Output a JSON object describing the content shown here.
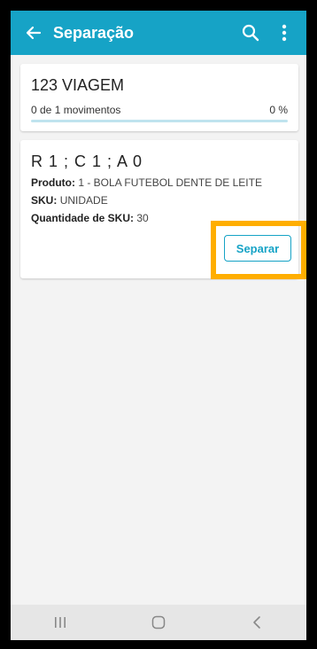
{
  "header": {
    "title": "Separação",
    "back_icon": "arrow-left-icon",
    "search_icon": "search-icon",
    "menu_icon": "more-vert-icon",
    "color": "#16a3c6"
  },
  "trip": {
    "name": "123 VIAGEM",
    "movements_text": "0 de 1 movimentos",
    "percent_text": "0 %",
    "progress": 0
  },
  "item": {
    "location": "R 1 ; C 1 ; A 0",
    "produto_label": "Produto:",
    "produto_value": "1 - BOLA FUTEBOL DENTE DE LEITE",
    "sku_label": "SKU:",
    "sku_value": "UNIDADE",
    "qty_label": "Quantidade de SKU:",
    "qty_value": "30",
    "button_label": "Separar"
  },
  "highlight_color": "#ffae00",
  "navbar": {
    "recents_icon": "recents-icon",
    "home_icon": "home-icon",
    "back_icon": "nav-back-icon"
  }
}
